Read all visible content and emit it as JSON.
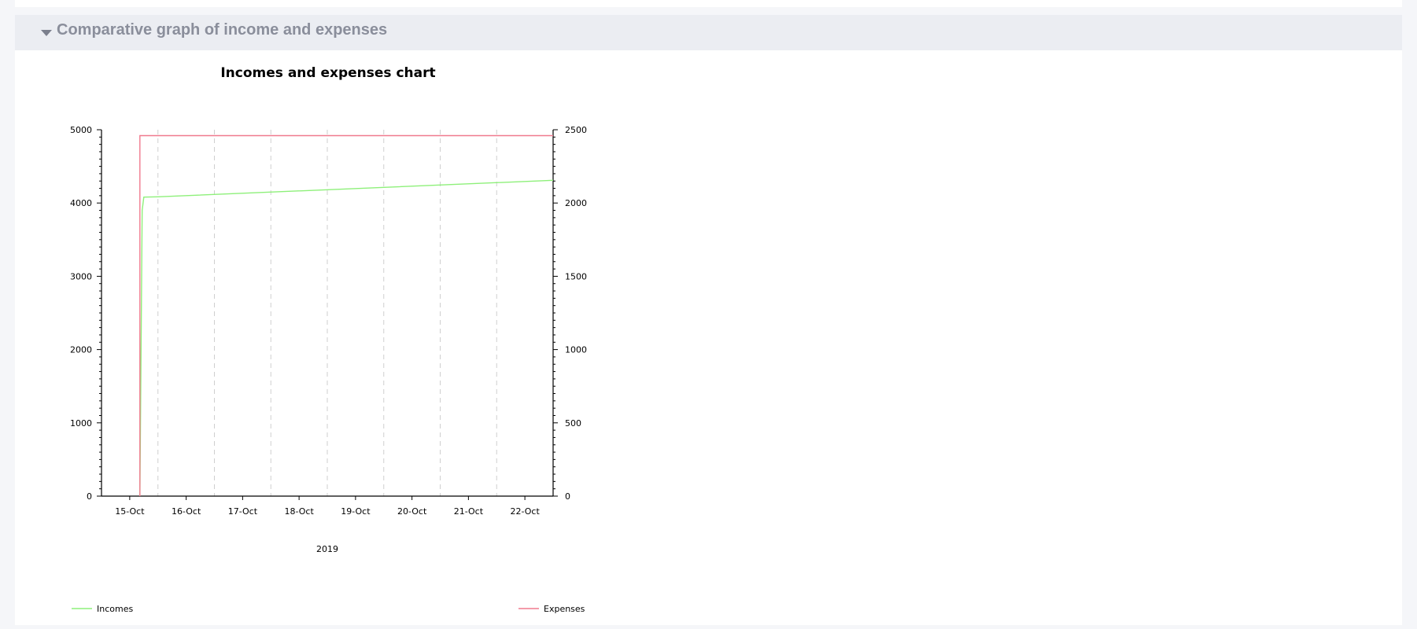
{
  "section": {
    "title": "Comparative graph of income and expenses"
  },
  "colors": {
    "incomes": "#8ef07a",
    "expenses": "#f07a8e",
    "grid": "#cfcfcf",
    "axis": "#000000"
  },
  "chart_data": {
    "type": "line",
    "title": "Incomes and  expenses chart",
    "xlabel": "2019",
    "x_categories": [
      "15-Oct",
      "16-Oct",
      "17-Oct",
      "18-Oct",
      "19-Oct",
      "20-Oct",
      "21-Oct",
      "22-Oct"
    ],
    "x_range": [
      14.5,
      22.5
    ],
    "y_left": {
      "range": [
        0,
        5000
      ],
      "ticks": [
        0,
        1000,
        2000,
        3000,
        4000,
        5000
      ]
    },
    "y_right": {
      "range": [
        0,
        2500
      ],
      "ticks": [
        0,
        500,
        1000,
        1500,
        2000,
        2500
      ]
    },
    "grid": "vertical dashed",
    "legend_position": "bottom",
    "series": [
      {
        "name": "Incomes",
        "axis": "left",
        "points": [
          [
            15.18,
            0
          ],
          [
            15.22,
            3900
          ],
          [
            15.25,
            4080
          ],
          [
            15.5,
            4085
          ],
          [
            22.5,
            4310
          ]
        ]
      },
      {
        "name": "Expenses",
        "axis": "right",
        "points": [
          [
            15.18,
            0
          ],
          [
            15.18,
            2460
          ],
          [
            22.5,
            2460
          ]
        ]
      }
    ]
  }
}
